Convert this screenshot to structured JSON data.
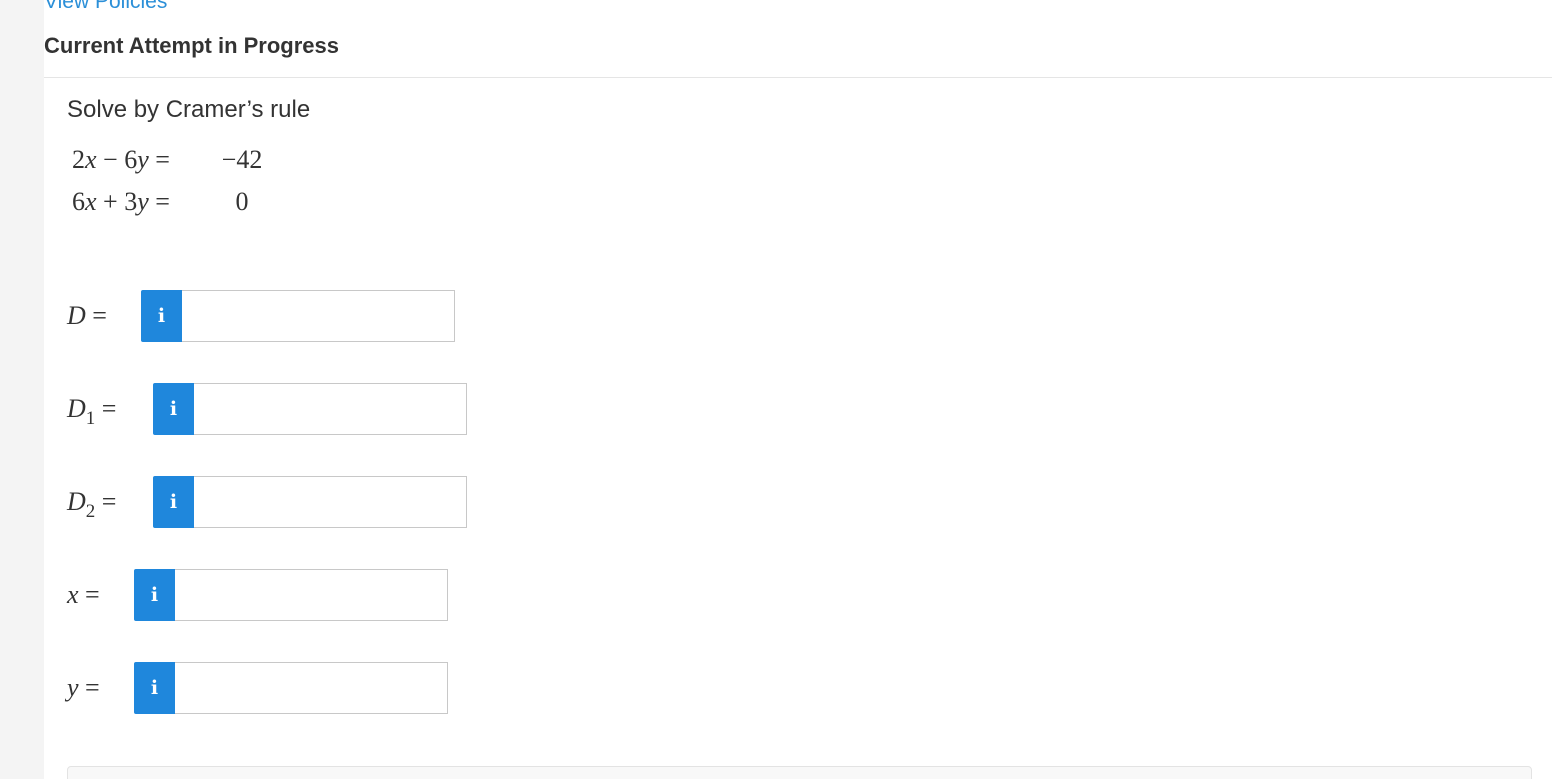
{
  "header": {
    "policies_link": "View Policies",
    "attempt_heading": "Current Attempt in Progress"
  },
  "question": {
    "title": "Solve by Cramer’s rule",
    "equations": [
      {
        "a": "2",
        "op": "−",
        "b": "6",
        "rhs": "−42"
      },
      {
        "a": "6",
        "op": "+",
        "b": "3",
        "rhs": "0"
      }
    ]
  },
  "answers": [
    {
      "label": "D",
      "sub": "",
      "value": ""
    },
    {
      "label": "D",
      "sub": "1",
      "value": ""
    },
    {
      "label": "D",
      "sub": "2",
      "value": ""
    },
    {
      "label": "x",
      "sub": "",
      "value": ""
    },
    {
      "label": "y",
      "sub": "",
      "value": ""
    }
  ],
  "info_glyph": "i",
  "colors": {
    "link": "#2b8fd8",
    "info_button": "#1f87dc",
    "text": "#333333"
  }
}
